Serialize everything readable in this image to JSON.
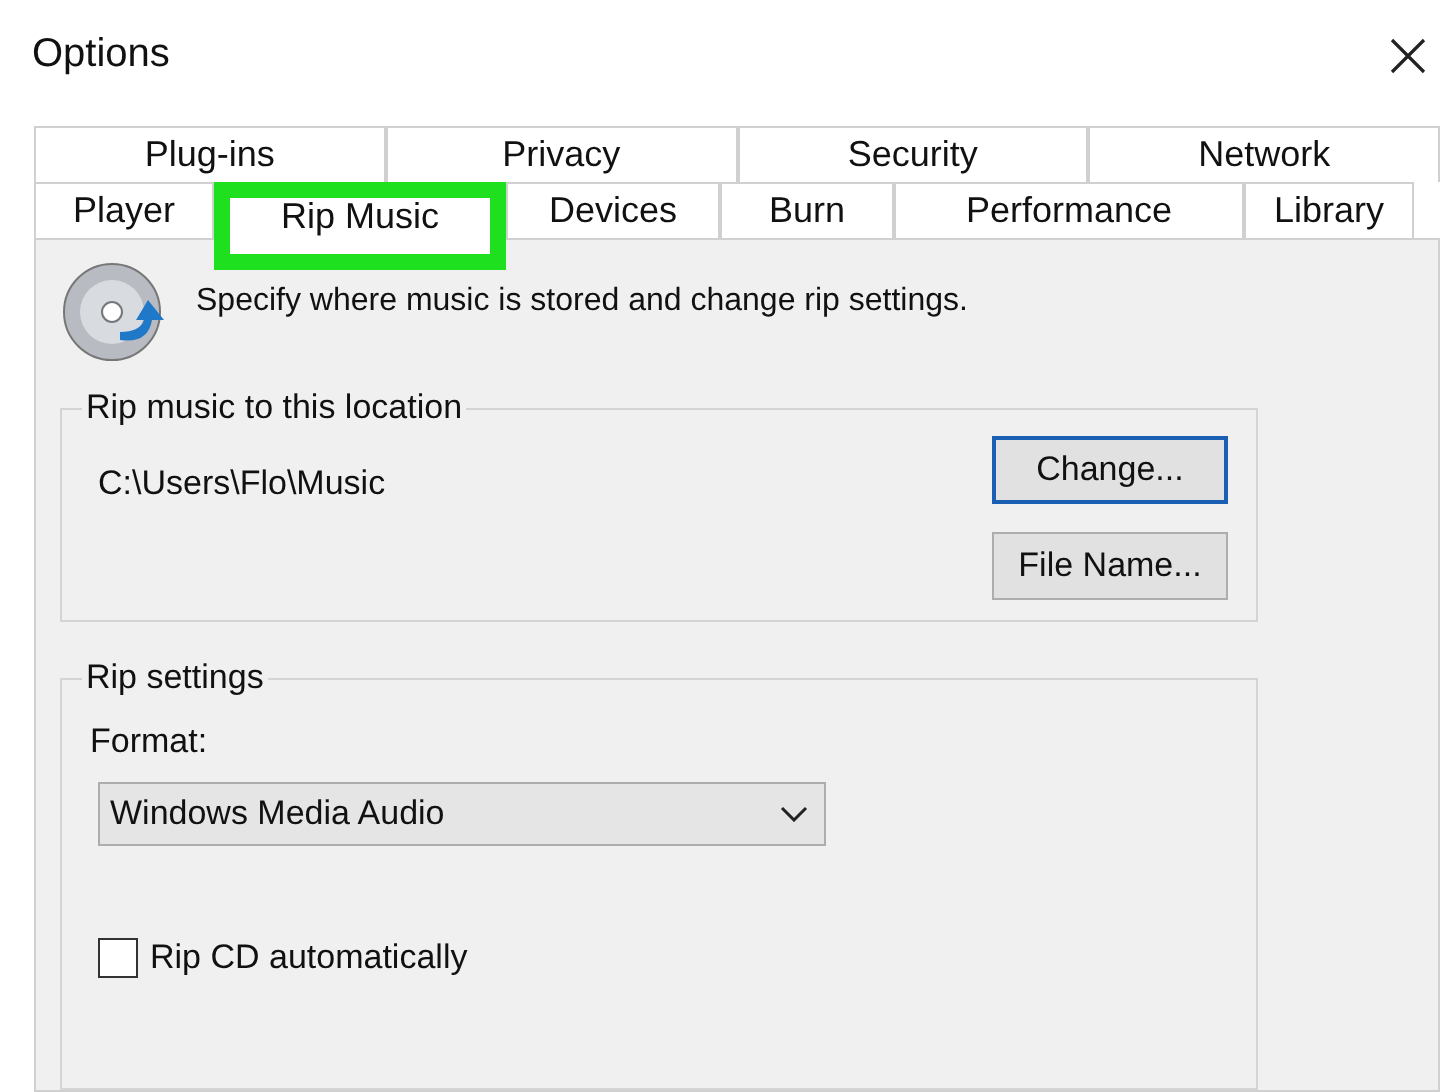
{
  "window": {
    "title": "Options"
  },
  "tab_rows": [
    [
      {
        "label": "Plug-ins",
        "selected": false,
        "highlighted": false
      },
      {
        "label": "Privacy",
        "selected": false,
        "highlighted": false
      },
      {
        "label": "Security",
        "selected": false,
        "highlighted": false
      },
      {
        "label": "Network",
        "selected": false,
        "highlighted": false
      }
    ],
    [
      {
        "label": "Player",
        "selected": false,
        "highlighted": false
      },
      {
        "label": "Rip Music",
        "selected": true,
        "highlighted": true
      },
      {
        "label": "Devices",
        "selected": false,
        "highlighted": false
      },
      {
        "label": "Burn",
        "selected": false,
        "highlighted": false
      },
      {
        "label": "Performance",
        "selected": false,
        "highlighted": false
      },
      {
        "label": "Library",
        "selected": false,
        "highlighted": false
      }
    ]
  ],
  "description": "Specify where music is stored and change rip settings.",
  "location_group": {
    "title": "Rip music to this location",
    "path": "C:\\Users\\Flo\\Music",
    "buttons": [
      {
        "label": "Change...",
        "default": true
      },
      {
        "label": "File Name...",
        "default": false
      }
    ]
  },
  "settings_group": {
    "title": "Rip settings",
    "format_label": "Format:",
    "format_value": "Windows Media Audio",
    "auto_rip": {
      "label": "Rip CD automatically",
      "checked": false
    }
  }
}
